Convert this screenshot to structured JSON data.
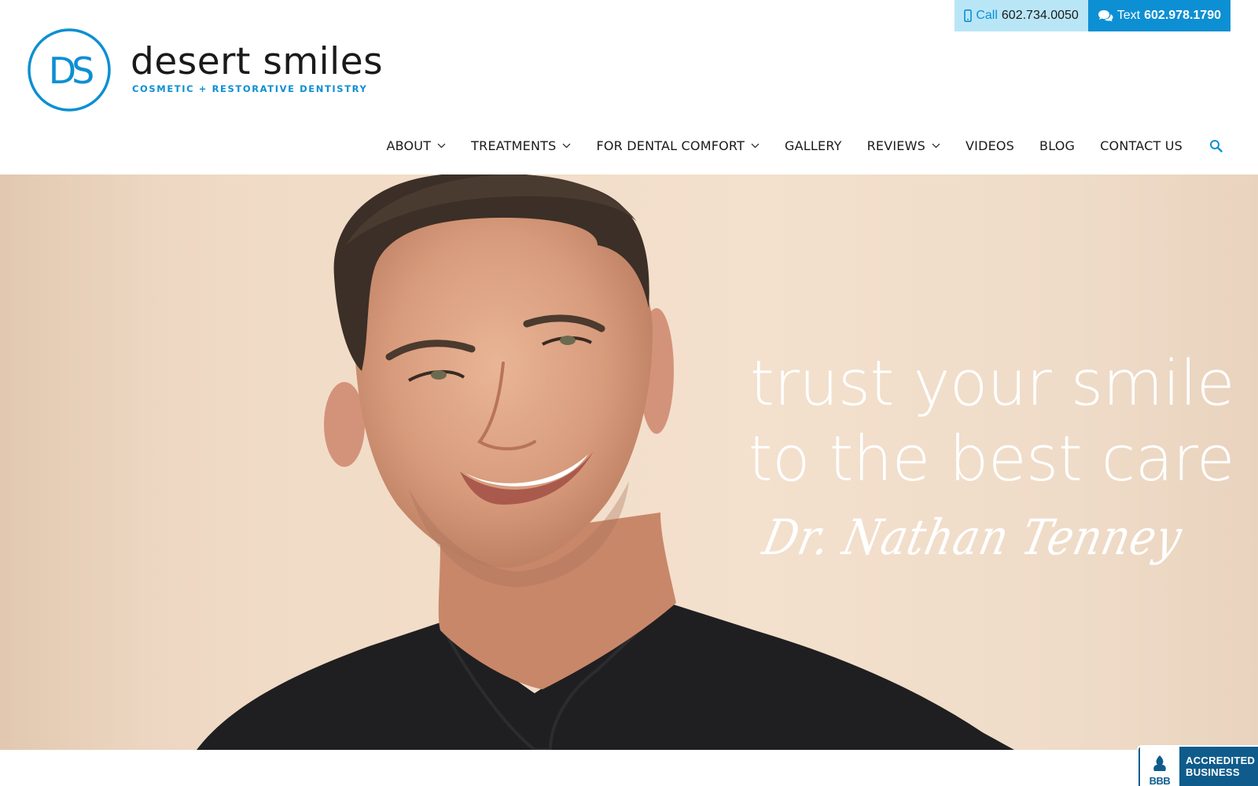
{
  "topbar": {
    "call_label": "Call",
    "call_number": "602.734.0050",
    "text_label": "Text",
    "text_number": "602.978.1790"
  },
  "logo": {
    "monogram": "DS",
    "name": "desert smiles",
    "tagline": "COSMETIC + RESTORATIVE DENTISTRY"
  },
  "nav": {
    "items": [
      {
        "label": "ABOUT",
        "dropdown": true
      },
      {
        "label": "TREATMENTS",
        "dropdown": true
      },
      {
        "label": "FOR DENTAL COMFORT",
        "dropdown": true
      },
      {
        "label": "GALLERY",
        "dropdown": false
      },
      {
        "label": "REVIEWS",
        "dropdown": true
      },
      {
        "label": "VIDEOS",
        "dropdown": false
      },
      {
        "label": "BLOG",
        "dropdown": false
      },
      {
        "label": "CONTACT US",
        "dropdown": false
      }
    ]
  },
  "hero": {
    "headline_line1": "trust your smile",
    "headline_line2": "to the best care",
    "signature": "Dr. Nathan Tenney"
  },
  "bbb": {
    "mark": "BBB",
    "line1": "ACCREDITED",
    "line2": "BUSINESS"
  },
  "colors": {
    "brand_blue": "#0d8fd3",
    "call_bg": "#b9e6f7",
    "bbb_navy": "#0f5c8c"
  },
  "icons": {
    "call": "mobile-phone-icon",
    "text": "chat-bubbles-icon",
    "search": "search-icon",
    "dropdown": "chevron-down-icon"
  }
}
